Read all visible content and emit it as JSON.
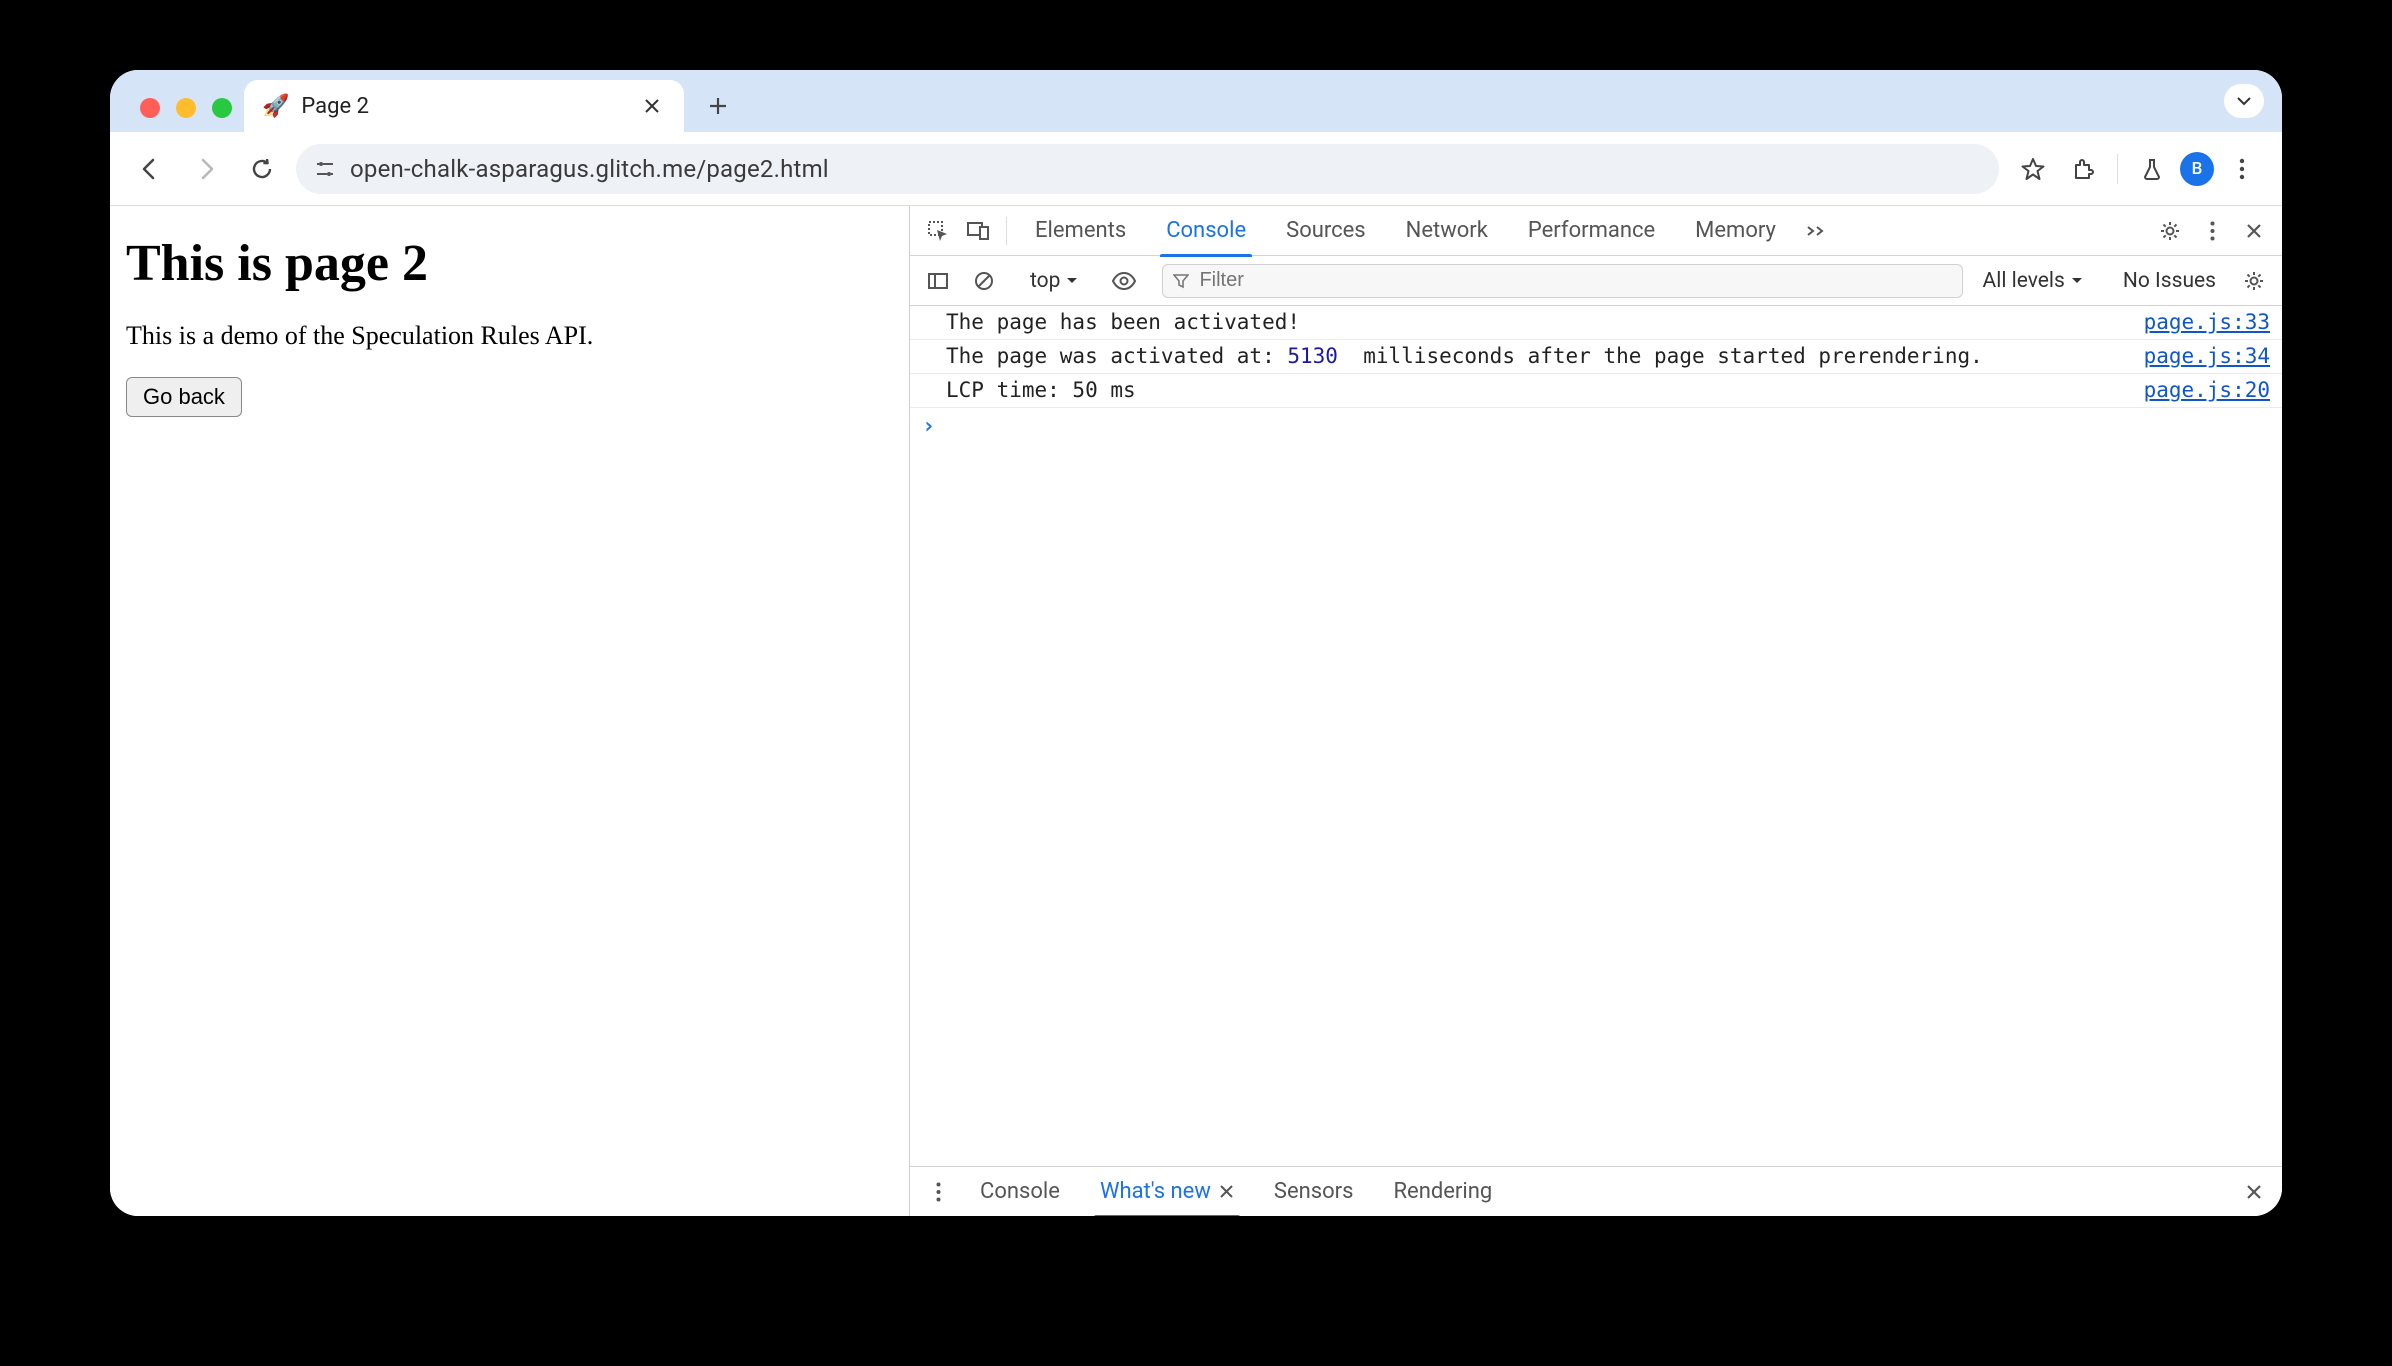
{
  "browser": {
    "tab_title": "Page 2",
    "url": "open-chalk-asparagus.glitch.me/page2.html",
    "avatar_initial": "B"
  },
  "page": {
    "heading": "This is page 2",
    "body": "This is a demo of the Speculation Rules API.",
    "button_label": "Go back"
  },
  "devtools": {
    "tabs": {
      "elements": "Elements",
      "console": "Console",
      "sources": "Sources",
      "network": "Network",
      "performance": "Performance",
      "memory": "Memory"
    },
    "toolbar": {
      "context": "top",
      "filter_placeholder": "Filter",
      "levels": "All levels",
      "issues": "No Issues"
    },
    "logs": [
      {
        "text_pre": "The page has been activated!",
        "num": "",
        "text_post": "",
        "source": "page.js:33"
      },
      {
        "text_pre": "The page was activated at: ",
        "num": "5130",
        "text_post": "  milliseconds after the page started prerendering.",
        "source": "page.js:34"
      },
      {
        "text_pre": "LCP time: 50 ms",
        "num": "",
        "text_post": "",
        "source": "page.js:20"
      }
    ],
    "drawer": {
      "console": "Console",
      "whatsnew": "What's new",
      "sensors": "Sensors",
      "rendering": "Rendering"
    }
  }
}
